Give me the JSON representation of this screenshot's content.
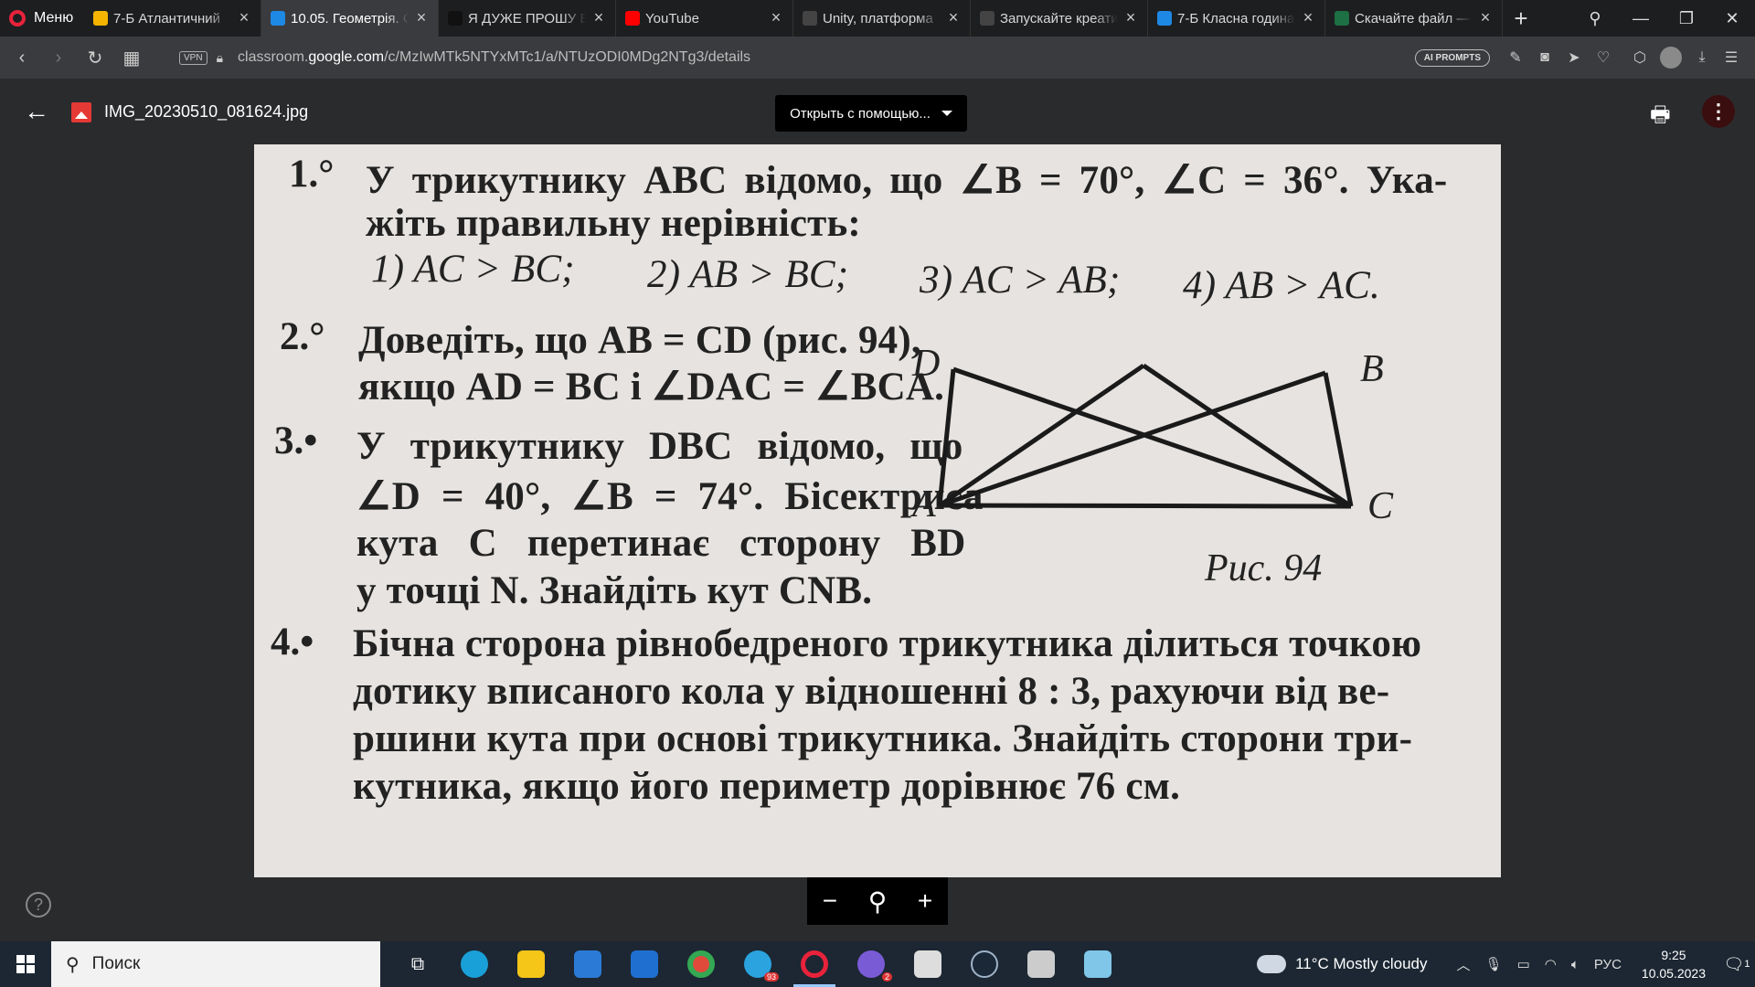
{
  "browser": {
    "menu_label": "Меню",
    "tabs": [
      {
        "label": "7-Б Атлантичний",
        "icon": "slides-icon",
        "color": "#f4b400",
        "active": false
      },
      {
        "label": "10.05. Геометрія. С",
        "icon": "classroom-icon",
        "color": "#1e88e5",
        "active": true
      },
      {
        "label": "Я ДУЖЕ ПРОШУ В",
        "icon": "znanija-icon",
        "color": "#111111",
        "active": false
      },
      {
        "label": "YouTube",
        "icon": "youtube-icon",
        "color": "#ff0000",
        "active": false
      },
      {
        "label": "Unity, платформа",
        "icon": "unity-icon",
        "color": "#444444",
        "active": false
      },
      {
        "label": "Запускайте креати",
        "icon": "unity-icon",
        "color": "#444444",
        "active": false
      },
      {
        "label": "7-Б Класна година",
        "icon": "classroom-icon",
        "color": "#1e88e5",
        "active": false
      },
      {
        "label": "Скачайте файл —",
        "icon": "excel-icon",
        "color": "#1d7044",
        "active": false
      }
    ],
    "vpn_label": "VPN",
    "url_prefix": "classroom.",
    "url_domain": "google.com",
    "url_path": "/c/MzIwMTk5NTYxMTc1/a/NTUzODI0MDg2NTg3/details",
    "ai_prompts_label": "AI PROMPTS"
  },
  "viewer": {
    "file_name": "IMG_20230510_081624.jpg",
    "open_with_label": "Открыть с помощью...",
    "zoom_out": "−",
    "zoom_icon": "⚲",
    "zoom_in": "+"
  },
  "photo": {
    "p1_num": "1.°",
    "p1_line1": "У трикутнику ABC відомо, що ∠B = 70°, ∠C = 36°. Ука-",
    "p1_line2": "жіть правильну нерівність:",
    "p1_opts": [
      "1) AC > BC;",
      "2) AB > BC;",
      "3) AC > AB;",
      "4) AB > AC."
    ],
    "p2_num": "2.°",
    "p2_line1": "Доведіть, що AB = CD (рис. 94),",
    "p2_line2": "якщо AD = BC і ∠DAC = ∠BCA.",
    "p3_num": "3.•",
    "p3_line1": "У трикутнику DBC відомо, що",
    "p3_line2": "∠D = 40°, ∠B = 74°. Бісектриса",
    "p3_line3": "кута C перетинає сторону BD",
    "p3_line4": "у точці N. Знайдіть кут CNB.",
    "p4_num": "4.•",
    "p4_line1": "Бічна сторона рівнобедреного трикутника ділиться точкою",
    "p4_line2": "дотику вписаного кола у відношенні 8 : 3, рахуючи від ве-",
    "p4_line3": "ршини кута при основі трикутника. Знайдіть сторони три-",
    "p4_line4": "кутника, якщо його периметр дорівнює 76 см.",
    "fig_labels": {
      "D": "D",
      "B": "B",
      "A": "A",
      "C": "C"
    },
    "fig_caption": "Рис. 94"
  },
  "taskbar": {
    "search_label": "Поиск",
    "weather": "11°C  Mostly cloudy",
    "lang": "РУС",
    "time": "9:25",
    "date": "10.05.2023",
    "telegram_badge": "93",
    "app_badge": "2",
    "notif_count": "1"
  }
}
